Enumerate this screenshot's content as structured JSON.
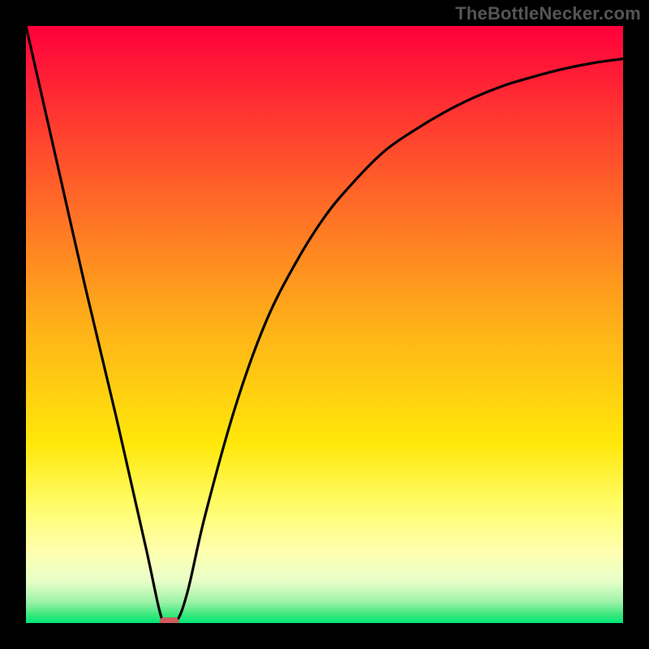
{
  "watermark": "TheBottleNecker.com",
  "chart_data": {
    "type": "line",
    "title": "",
    "xlabel": "",
    "ylabel": "",
    "xlim": [
      0,
      100
    ],
    "ylim": [
      0,
      100
    ],
    "grid": false,
    "legend": false,
    "series": [
      {
        "name": "bottleneck-curve",
        "x": [
          0,
          5,
          10,
          15,
          20,
          23,
          25,
          27,
          30,
          35,
          40,
          45,
          50,
          55,
          60,
          65,
          70,
          75,
          80,
          85,
          90,
          95,
          100
        ],
        "y": [
          100,
          78,
          56,
          35,
          13,
          0,
          0,
          5,
          18,
          36,
          50,
          60,
          68,
          74,
          79,
          82.5,
          85.5,
          88,
          90,
          91.5,
          92.8,
          93.8,
          94.5
        ]
      }
    ],
    "markers": [
      {
        "name": "optimum-marker",
        "x": 24,
        "y": 0,
        "shape": "rounded-rect",
        "color": "#cd5c5c"
      }
    ],
    "gradient_stops": [
      {
        "offset": 0.0,
        "color": "#ff003b"
      },
      {
        "offset": 0.25,
        "color": "#ff5a2a"
      },
      {
        "offset": 0.5,
        "color": "#ffb019"
      },
      {
        "offset": 0.7,
        "color": "#ffe80a"
      },
      {
        "offset": 0.8,
        "color": "#fffc66"
      },
      {
        "offset": 0.88,
        "color": "#ffffb0"
      },
      {
        "offset": 0.93,
        "color": "#e8ffc8"
      },
      {
        "offset": 0.965,
        "color": "#9cf2a8"
      },
      {
        "offset": 0.985,
        "color": "#3fe87e"
      },
      {
        "offset": 1.0,
        "color": "#00e676"
      }
    ]
  }
}
